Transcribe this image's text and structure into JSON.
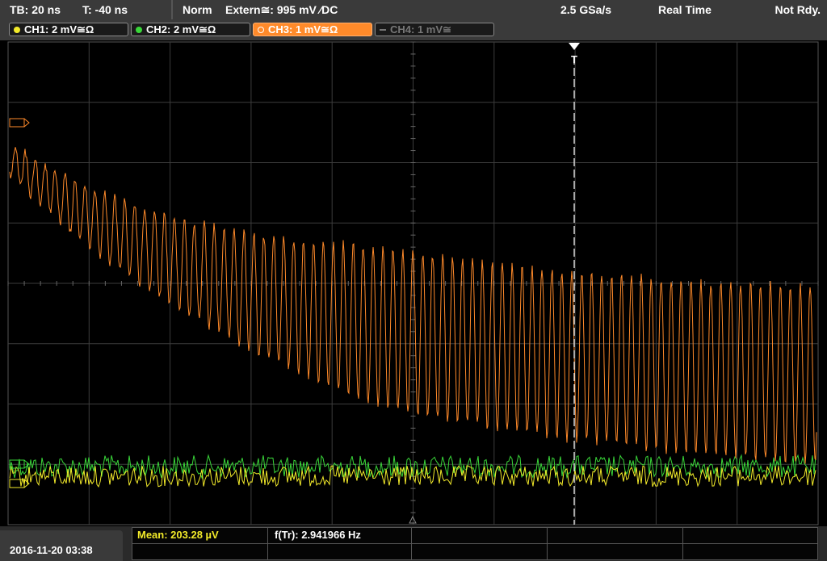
{
  "status_bar": {
    "timebase": "TB: 20 ns",
    "trigger_time": "T: -40 ns",
    "mode": "Norm",
    "trigger_source": "Extern≅: 995 mV ∕DC",
    "sample_rate": "2.5 GSa/s",
    "acquisition": "Real Time",
    "state": "Not Rdy."
  },
  "channels": [
    {
      "label": "CH1: 2 mV≅Ω",
      "color": "#f2ea2a",
      "active": true
    },
    {
      "label": "CH2: 2 mV≅Ω",
      "color": "#39d639",
      "active": true
    },
    {
      "label": "CH3: 1 mV≅Ω",
      "color": "#ff8a2a",
      "active": true,
      "selected": true
    },
    {
      "label": "CH4: 1 mV≅",
      "color": "#777777",
      "active": false
    }
  ],
  "trigger_marker": "T",
  "measurements": {
    "mean": "Mean: 203.28 µV",
    "frequency": "f(Tr): 2.941966 Hz"
  },
  "datetime": "2016-11-20 03:38",
  "colors": {
    "ch1": "#f2ea2a",
    "ch2": "#39d639",
    "ch3": "#ff8a2a",
    "grid": "#3c3c3c",
    "panel": "#3a3a3a"
  }
}
